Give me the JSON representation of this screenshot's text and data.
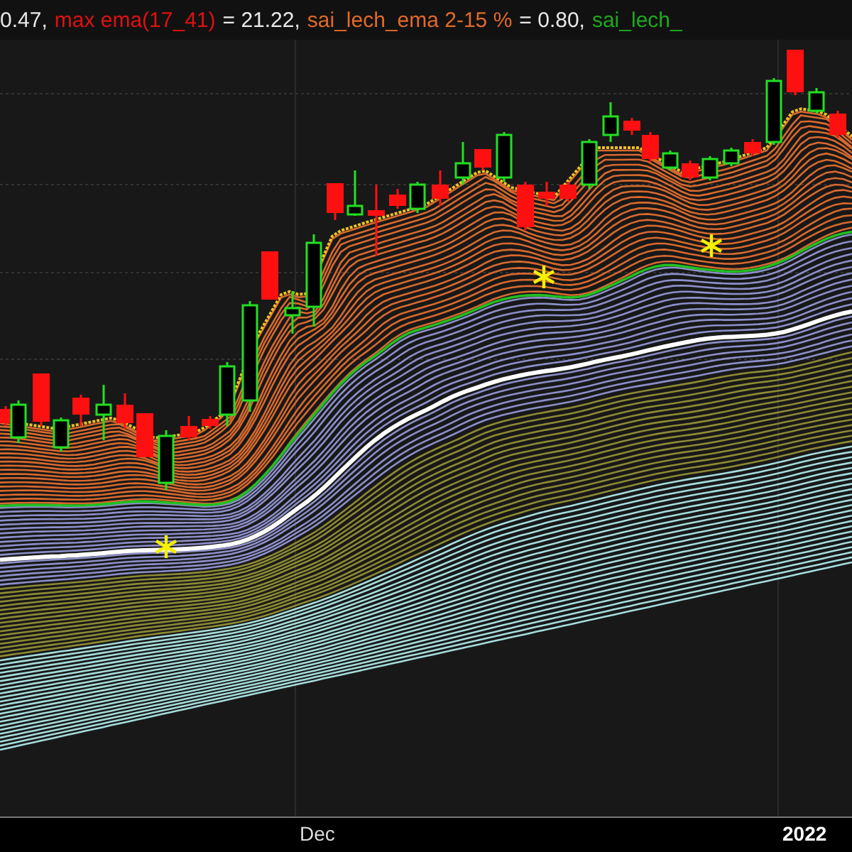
{
  "legend": [
    {
      "text": "0.47,",
      "color": "#e8e8e8"
    },
    {
      "text": "max ema(17_41)",
      "color": "#e01010"
    },
    {
      "text": "= 21.22,",
      "color": "#e8e8e8"
    },
    {
      "text": "sai_lech_ema 2-15 %",
      "color": "#e06a28"
    },
    {
      "text": "= 0.80,",
      "color": "#e8e8e8"
    },
    {
      "text": "sai_lech_",
      "color": "#1ea81e"
    }
  ],
  "x_axis": [
    {
      "label": "Dec",
      "bold": false
    },
    {
      "label": "2022",
      "bold": true
    }
  ]
}
